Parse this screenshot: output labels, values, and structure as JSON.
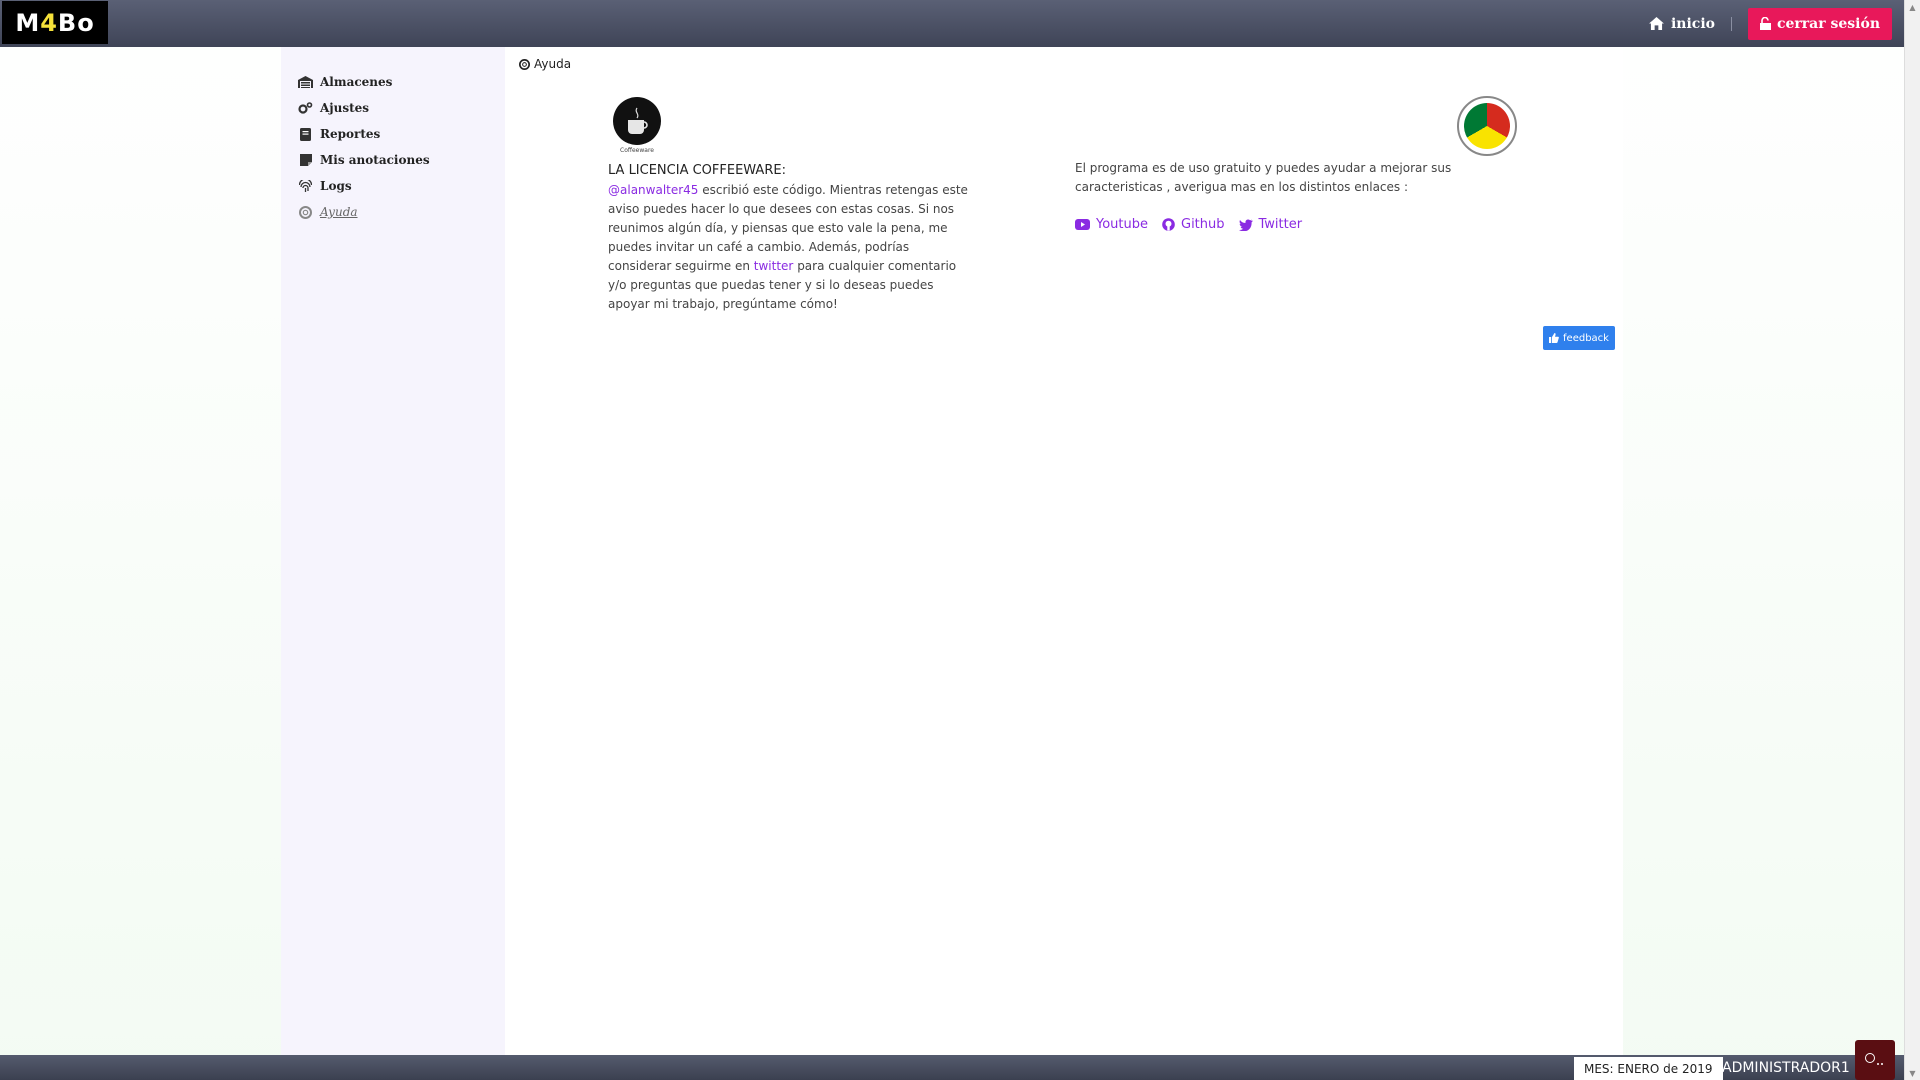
{
  "header": {
    "logo": {
      "prefix": "M",
      "highlight": "4",
      "suffix": "Bo"
    },
    "home_label": "inicio",
    "logout_label": "cerrar sesión"
  },
  "sidebar": {
    "items": [
      {
        "label": "Almacenes",
        "icon": "warehouse-icon"
      },
      {
        "label": "Ajustes",
        "icon": "cogs-icon"
      },
      {
        "label": "Reportes",
        "icon": "book-icon"
      },
      {
        "label": "Mis anotaciones",
        "icon": "sticky-note-icon"
      },
      {
        "label": "Logs",
        "icon": "fingerprint-icon"
      },
      {
        "label": "Ayuda",
        "icon": "life-ring-icon",
        "active": true
      }
    ]
  },
  "main": {
    "breadcrumb": "Ayuda",
    "coffee_caption": "Coffeeware",
    "license_title": "LA LICENCIA COFFEEWARE:",
    "license": {
      "handle": "@alanwalter45",
      "text1": " escribió este código. Mientras retengas este aviso puedes hacer lo que desees con estas cosas. Si nos reunimos algún día, y piensas que esto vale la pena, me puedes invitar un café a cambio. Además, podrías considerar seguirme en ",
      "twitter_link": "twitter",
      "text2": " para cualquier comentario y/o preguntas que puedas tener y si lo deseas puedes apoyar mi trabajo, pregúntame cómo!"
    },
    "program_text": "El programa es de uso gratuito y puedes ayudar a mejorar sus caracteristicas , averigua mas en los distintos enlaces :",
    "links": [
      {
        "label": "Youtube",
        "icon": "youtube-icon"
      },
      {
        "label": "Github",
        "icon": "github-icon"
      },
      {
        "label": "Twitter",
        "icon": "twitter-icon"
      }
    ],
    "feedback_label": "feedback"
  },
  "footer": {
    "month": "MES: ENERO de 2019",
    "user": "ADMINISTRADOR1"
  },
  "colors": {
    "accent": "#e8185a",
    "link": "#8a2be2",
    "feedback": "#2f80ed"
  }
}
